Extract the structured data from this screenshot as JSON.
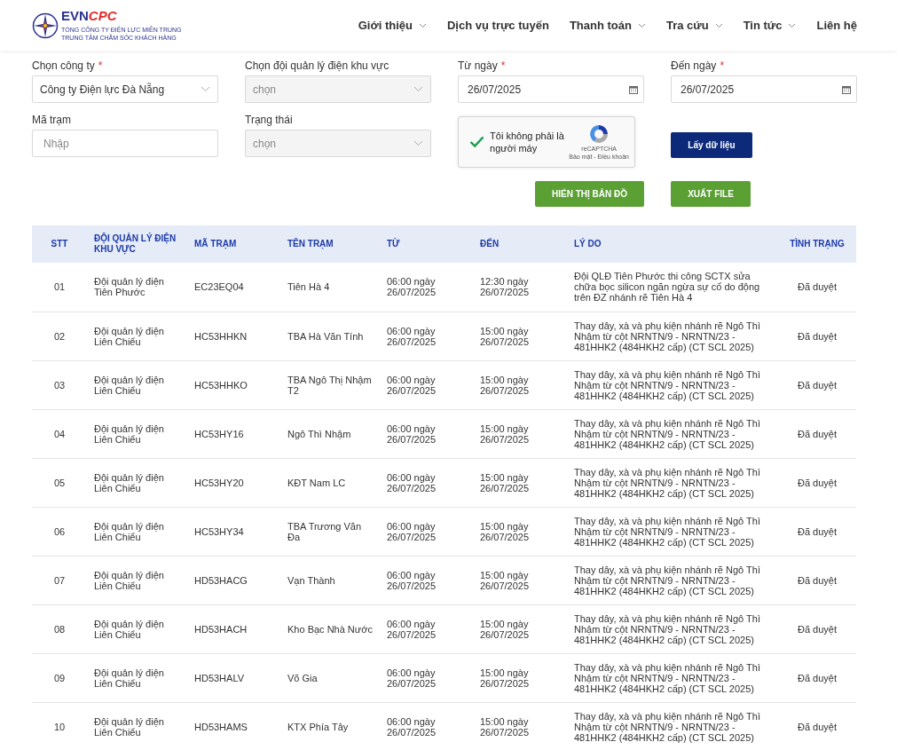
{
  "header": {
    "logo": {
      "brand_left": "EVN",
      "brand_right": "CPC",
      "line1": "TỔNG CÔNG TY ĐIỆN LỰC MIỀN TRUNG",
      "line2": "TRUNG TÂM CHĂM SÓC KHÁCH HÀNG"
    },
    "nav": [
      {
        "label": "Giới thiệu",
        "dropdown": true
      },
      {
        "label": "Dịch vụ trực tuyến",
        "dropdown": false
      },
      {
        "label": "Thanh toán",
        "dropdown": true
      },
      {
        "label": "Tra cứu",
        "dropdown": true
      },
      {
        "label": "Tin tức",
        "dropdown": true
      },
      {
        "label": "Liên hệ",
        "dropdown": false
      }
    ]
  },
  "filters": [
    {
      "kind": "select",
      "label": "Chọn công ty",
      "required_mark": "*",
      "value": "Công ty Điện lực Đà Nẵng"
    },
    {
      "kind": "select",
      "label": "Chọn đội quản lý điện khu vực",
      "placeholder": "chọn"
    },
    {
      "kind": "date",
      "label": "Từ ngày",
      "required_mark": "*",
      "value": "26/07/2025"
    },
    {
      "kind": "date",
      "label": "Đến ngày",
      "required_mark": "*",
      "value": "26/07/2025"
    },
    {
      "kind": "text",
      "label": "Mã trạm",
      "placeholder": "Nhập"
    },
    {
      "kind": "select",
      "label": "Trạng thái",
      "placeholder": "chọn"
    }
  ],
  "captcha": {
    "label": "Tôi không phải là người máy",
    "checked": true,
    "brand": "reCAPTCHA",
    "footer": "Bảo mật - Điều khoản"
  },
  "buttons": {
    "fetch": "Lấy dữ liệu",
    "map": "HIỂN THỊ BẢN ĐỒ",
    "export": "XUẤT FILE"
  },
  "table": {
    "columns": [
      "STT",
      "ĐỘI QUẢN LÝ ĐIỆN KHU VỰC",
      "MÃ TRẠM",
      "TÊN TRẠM",
      "TỪ",
      "ĐẾN",
      "LÝ DO",
      "TÌNH TRẠNG"
    ],
    "rows": [
      [
        "01",
        "Đội quản lý điện Tiên Phước",
        "EC23EQ04",
        "Tiên Hà 4",
        "06:00 ngày 26/07/2025",
        "12:30 ngày 26/07/2025",
        "Đội QLĐ Tiên Phước thi công SCTX sửa chữa bọc silicon ngăn ngừa sự cố do động trên ĐZ nhánh rẽ Tiên Hà 4",
        "Đã duyệt"
      ],
      [
        "02",
        "Đội quản lý điện Liên Chiểu",
        "HC53HHKN",
        "TBA Hà Văn Tính",
        "06:00 ngày 26/07/2025",
        "15:00 ngày 26/07/2025",
        "Thay dây, xà và phụ kiện nhánh rẽ Ngô Thì Nhậm từ cột NRNTN/9 - NRNTN/23 - 481HHK2 (484HKH2 cấp) (CT SCL 2025)",
        "Đã duyệt"
      ],
      [
        "03",
        "Đội quản lý điện Liên Chiểu",
        "HC53HHKO",
        "TBA Ngô Thị Nhậm T2",
        "06:00 ngày 26/07/2025",
        "15:00 ngày 26/07/2025",
        "Thay dây, xà và phụ kiện nhánh rẽ Ngô Thì Nhậm từ cột NRNTN/9 - NRNTN/23 - 481HHK2 (484HKH2 cấp) (CT SCL 2025)",
        "Đã duyệt"
      ],
      [
        "04",
        "Đội quản lý điện Liên Chiểu",
        "HC53HY16",
        "Ngô Thì Nhậm",
        "06:00 ngày 26/07/2025",
        "15:00 ngày 26/07/2025",
        "Thay dây, xà và phụ kiện nhánh rẽ Ngô Thì Nhậm từ cột NRNTN/9 - NRNTN/23 - 481HHK2 (484HKH2 cấp) (CT SCL 2025)",
        "Đã duyệt"
      ],
      [
        "05",
        "Đội quản lý điện Liên Chiểu",
        "HC53HY20",
        "KĐT Nam LC",
        "06:00 ngày 26/07/2025",
        "15:00 ngày 26/07/2025",
        "Thay dây, xà và phụ kiện nhánh rẽ Ngô Thì Nhậm từ cột NRNTN/9 - NRNTN/23 - 481HHK2 (484HKH2 cấp) (CT SCL 2025)",
        "Đã duyệt"
      ],
      [
        "06",
        "Đội quản lý điện Liên Chiểu",
        "HC53HY34",
        "TBA Trương Văn Đa",
        "06:00 ngày 26/07/2025",
        "15:00 ngày 26/07/2025",
        "Thay dây, xà và phụ kiện nhánh rẽ Ngô Thì Nhậm từ cột NRNTN/9 - NRNTN/23 - 481HHK2 (484HKH2 cấp) (CT SCL 2025)",
        "Đã duyệt"
      ],
      [
        "07",
        "Đội quản lý điện Liên Chiểu",
        "HD53HACG",
        "Vạn Thành",
        "06:00 ngày 26/07/2025",
        "15:00 ngày 26/07/2025",
        "Thay dây, xà và phụ kiện nhánh rẽ Ngô Thì Nhậm từ cột NRNTN/9 - NRNTN/23 - 481HHK2 (484HKH2 cấp) (CT SCL 2025)",
        "Đã duyệt"
      ],
      [
        "08",
        "Đội quản lý điện Liên Chiểu",
        "HD53HACH",
        "Kho Bạc Nhà Nước",
        "06:00 ngày 26/07/2025",
        "15:00 ngày 26/07/2025",
        "Thay dây, xà và phụ kiện nhánh rẽ Ngô Thì Nhậm từ cột NRNTN/9 - NRNTN/23 - 481HHK2 (484HKH2 cấp) (CT SCL 2025)",
        "Đã duyệt"
      ],
      [
        "09",
        "Đội quản lý điện Liên Chiểu",
        "HD53HALV",
        "Võ Gia",
        "06:00 ngày 26/07/2025",
        "15:00 ngày 26/07/2025",
        "Thay dây, xà và phụ kiện nhánh rẽ Ngô Thì Nhậm từ cột NRNTN/9 - NRNTN/23 - 481HHK2 (484HKH2 cấp) (CT SCL 2025)",
        "Đã duyệt"
      ],
      [
        "10",
        "Đội quản lý điện Liên Chiểu",
        "HD53HAMS",
        "KTX Phía Tây",
        "06:00 ngày 26/07/2025",
        "15:00 ngày 26/07/2025",
        "Thay dây, xà và phụ kiện nhánh rẽ Ngô Thì Nhậm từ cột NRNTN/9 - NRNTN/23 - 481HHK2 (484HKH2 cấp) (CT SCL 2025)",
        "Đã duyệt"
      ]
    ]
  }
}
